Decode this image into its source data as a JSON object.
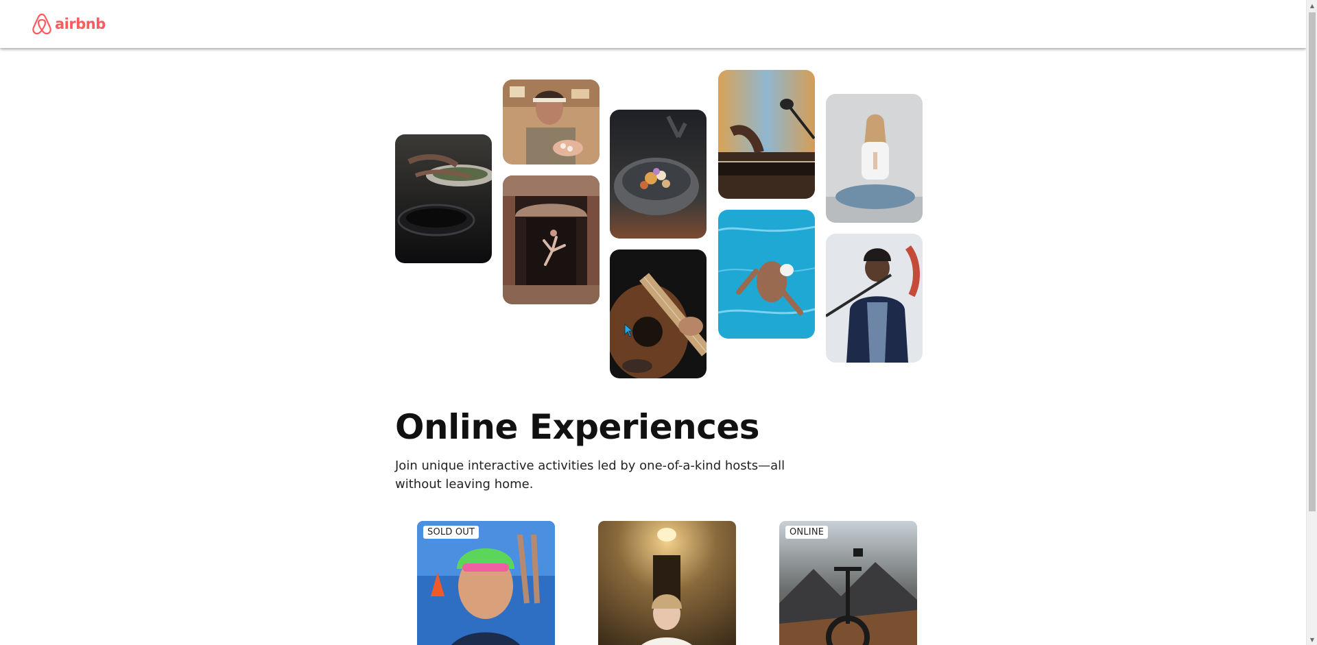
{
  "brand": {
    "name": "airbnb",
    "color": "#ff5a5f",
    "icon": "airbnb-logo-icon"
  },
  "hero": {
    "photos": [
      {
        "subject": "cooking-pans"
      },
      {
        "subject": "woman-baking"
      },
      {
        "subject": "dancer-in-doorway"
      },
      {
        "subject": "food-bowl"
      },
      {
        "subject": "guitar"
      },
      {
        "subject": "piano-microphone"
      },
      {
        "subject": "swimmer"
      },
      {
        "subject": "yoga"
      },
      {
        "subject": "singer"
      }
    ],
    "title": "Online Experiences",
    "subtitle": "Join unique interactive activities led by one-of-a-kind hosts—all without leaving home."
  },
  "cards": [
    {
      "badge": "SOLD OUT",
      "subject": "swimmer-portrait"
    },
    {
      "badge": "",
      "subject": "bride"
    },
    {
      "badge": "ONLINE",
      "subject": "mountain-bike"
    }
  ],
  "scrollbar": {
    "up_icon": "scroll-up-arrow-icon",
    "down_icon": "scroll-down-arrow-icon"
  }
}
